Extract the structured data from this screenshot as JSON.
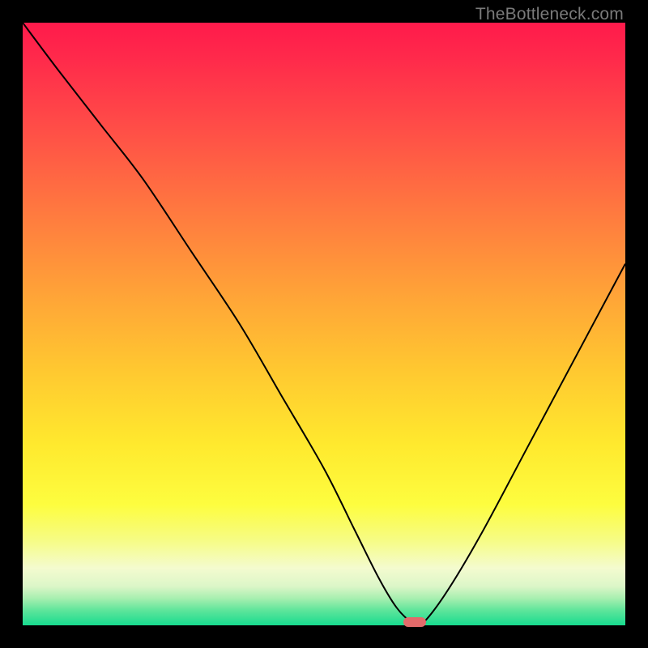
{
  "watermark": {
    "text": "TheBottleneck.com"
  },
  "chart_data": {
    "type": "line",
    "title": "",
    "xlabel": "",
    "ylabel": "",
    "xlim": [
      0,
      100
    ],
    "ylim": [
      0,
      100
    ],
    "grid": false,
    "legend": false,
    "annotations": [],
    "background_gradient": {
      "stops": [
        {
          "pos": 0.0,
          "color": "#ff1a4b"
        },
        {
          "pos": 0.06,
          "color": "#ff2a4b"
        },
        {
          "pos": 0.18,
          "color": "#ff4f47"
        },
        {
          "pos": 0.32,
          "color": "#ff7b3f"
        },
        {
          "pos": 0.46,
          "color": "#ffa637"
        },
        {
          "pos": 0.58,
          "color": "#ffc930"
        },
        {
          "pos": 0.7,
          "color": "#ffe92e"
        },
        {
          "pos": 0.8,
          "color": "#fdfd3f"
        },
        {
          "pos": 0.86,
          "color": "#f6fc86"
        },
        {
          "pos": 0.905,
          "color": "#f4fbcf"
        },
        {
          "pos": 0.935,
          "color": "#dcf6c8"
        },
        {
          "pos": 0.955,
          "color": "#a8efb0"
        },
        {
          "pos": 0.975,
          "color": "#5fe59b"
        },
        {
          "pos": 1.0,
          "color": "#17db8f"
        }
      ]
    },
    "series": [
      {
        "name": "bottleneck-curve",
        "color": "#000000",
        "width": 2,
        "x": [
          0,
          6,
          13,
          20,
          28,
          36,
          43,
          50,
          55,
          59,
          62,
          64.5,
          66,
          70,
          76,
          84,
          92,
          100
        ],
        "y": [
          100,
          92,
          83,
          74,
          62,
          50,
          38,
          26,
          16,
          8,
          3,
          0.5,
          0,
          5,
          15,
          30,
          45,
          60
        ]
      }
    ],
    "marker": {
      "x": 65,
      "y": 0.5,
      "style": "pill",
      "fill": "#e26a6a"
    }
  }
}
